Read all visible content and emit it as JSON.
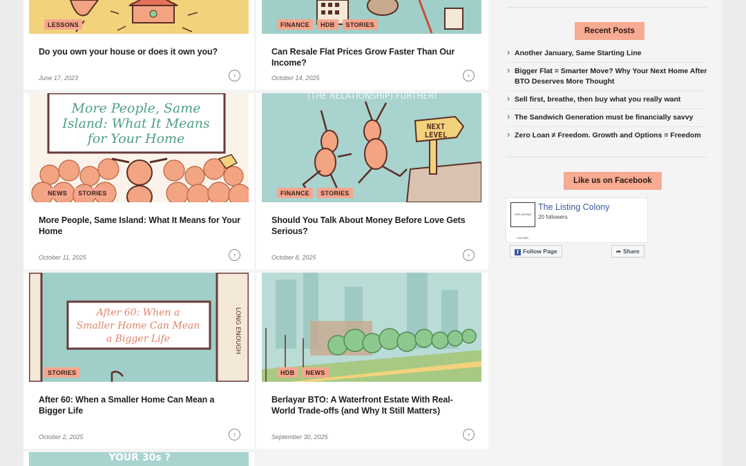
{
  "cards": [
    {
      "tags": [
        "LESSONS"
      ],
      "title": "Do you own your house or does it own you?",
      "date": "June 17, 2023"
    },
    {
      "tags": [
        "FINANCE",
        "HDB",
        "STORIES"
      ],
      "title": "Can Resale Flat Prices Grow Faster Than Our Income?",
      "date": "October 14, 2025"
    },
    {
      "tags": [
        "NEWS",
        "STORIES"
      ],
      "title": "More People, Same Island: What It Means for Your Home",
      "date": "October 11, 2025",
      "art_text": [
        "More People, Same",
        "Island: What It Means",
        "for Your Home"
      ]
    },
    {
      "tags": [
        "FINANCE",
        "STORIES"
      ],
      "title": "Should You Talk About Money Before Love Gets Serious?",
      "date": "October 8, 2025",
      "art_text": [
        "(THE RELATIONSHIP) FURTHER!",
        "NEXT",
        "LEVEL"
      ]
    },
    {
      "tags": [
        "STORIES"
      ],
      "title": "After 60: When a Smaller Home Can Mean a Bigger Life",
      "date": "October 2, 2025",
      "art_text": [
        "After 60: When a",
        "Smaller Home Can Mean",
        "a Bigger Life",
        "LONG ENOUGH"
      ]
    },
    {
      "tags": [
        "HDB",
        "NEWS"
      ],
      "title": "Berlayar BTO: A Waterfront Estate With Real-World Trade-offs (and Why It Still Matters)",
      "date": "September 30, 2025"
    },
    {
      "art_text": [
        "YOUR 30s ?"
      ]
    }
  ],
  "sidebar": {
    "recent_title": "Recent Posts",
    "recent_posts": [
      "Another January, Same Starting Line",
      "Bigger Flat = Smarter Move? Why Your Next Home After BTO Deserves More Thought",
      "Sell first, breathe, then buy what you really want",
      "The Sandwich Generation must be financially savvy",
      "Zero Loan ≠ Freedom. Growth and Options = Freedom"
    ],
    "facebook_title": "Like us on Facebook",
    "facebook": {
      "page_name": "The Listing Colony",
      "followers": "20 followers",
      "logo_text": "THE LISTING COLONY",
      "follow_label": "Follow Page",
      "share_label": "Share"
    }
  },
  "colors": {
    "tag_bg": "#f6a68f",
    "art_teal": "#9fcfc8",
    "art_yellow": "#f3d27c",
    "art_salmon": "#f2a483",
    "fb_blue": "#3b5998"
  }
}
